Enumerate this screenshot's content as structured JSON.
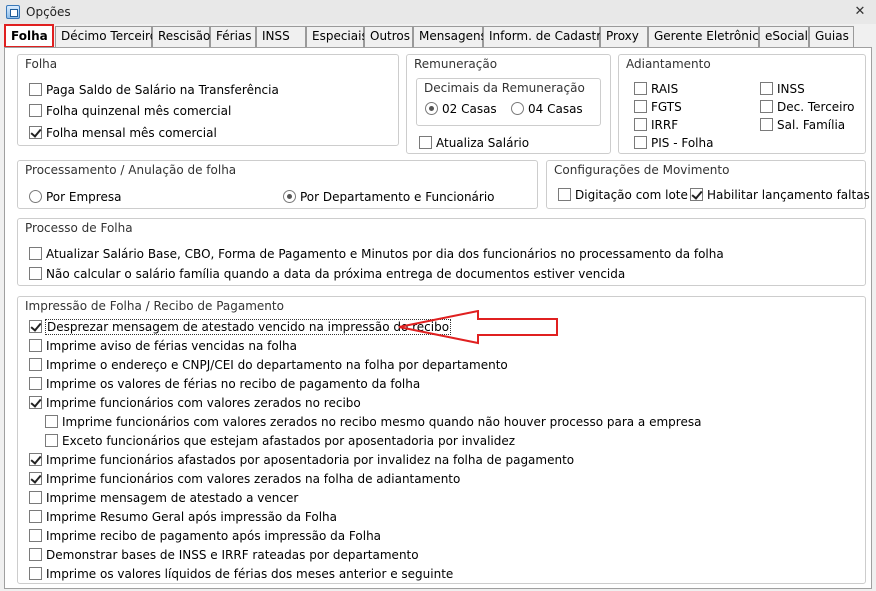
{
  "window": {
    "title": "Opções",
    "close_symbol": "✕"
  },
  "tabs": [
    "Folha",
    "Décimo Terceiro",
    "Rescisão",
    "Férias",
    "INSS",
    "Especiais",
    "Outros",
    "Mensagens",
    "Inform. de Cadastro",
    "Proxy",
    "Gerente Eletrônico",
    "eSocial",
    "Guias"
  ],
  "folha": {
    "title": "Folha",
    "items": [
      {
        "label": "Paga Saldo de Salário na Transferência",
        "checked": false
      },
      {
        "label": "Folha quinzenal mês comercial",
        "checked": false
      },
      {
        "label": "Folha mensal mês comercial",
        "checked": true
      }
    ]
  },
  "remuneracao": {
    "title": "Remuneração",
    "decimais": {
      "title": "Decimais da Remuneração",
      "options": [
        {
          "label": "02 Casas",
          "selected": true
        },
        {
          "label": "04 Casas",
          "selected": false
        }
      ]
    },
    "atualiza": {
      "label": "Atualiza Salário",
      "checked": false
    }
  },
  "adiantamento": {
    "title": "Adiantamento",
    "col1": [
      {
        "label": "RAIS",
        "checked": false
      },
      {
        "label": "FGTS",
        "checked": false
      },
      {
        "label": "IRRF",
        "checked": false
      },
      {
        "label": "PIS - Folha",
        "checked": false
      }
    ],
    "col2": [
      {
        "label": "INSS",
        "checked": false
      },
      {
        "label": "Dec. Terceiro",
        "checked": false
      },
      {
        "label": "Sal. Família",
        "checked": false
      }
    ]
  },
  "processamento": {
    "title": "Processamento / Anulação de folha",
    "options": [
      {
        "label": "Por Empresa",
        "selected": false
      },
      {
        "label": "Por Departamento e Funcionário",
        "selected": true
      }
    ]
  },
  "movimento": {
    "title": "Configurações de Movimento",
    "items": [
      {
        "label": "Digitação com lote",
        "checked": false
      },
      {
        "label": "Habilitar lançamento faltas",
        "checked": true
      }
    ]
  },
  "processo": {
    "title": "Processo de Folha",
    "items": [
      {
        "label": "Atualizar Salário Base, CBO, Forma de Pagamento e Minutos por dia dos funcionários no processamento da folha",
        "checked": false
      },
      {
        "label": "Não calcular o salário família quando a data da próxima entrega de documentos estiver vencida",
        "checked": false
      }
    ]
  },
  "impressao": {
    "title": "Impressão de Folha / Recibo de Pagamento",
    "items": [
      {
        "label": "Desprezar mensagem de atestado vencido na impressão do recibo",
        "checked": true,
        "indent": false
      },
      {
        "label": "Imprime aviso de férias vencidas na folha",
        "checked": false,
        "indent": false
      },
      {
        "label": "Imprime o endereço e CNPJ/CEI do departamento na folha por departamento",
        "checked": false,
        "indent": false
      },
      {
        "label": "Imprime os valores de férias no recibo de pagamento da folha",
        "checked": false,
        "indent": false
      },
      {
        "label": "Imprime funcionários com valores zerados no recibo",
        "checked": true,
        "indent": false
      },
      {
        "label": "Imprime funcionários com valores zerados no recibo mesmo quando não houver processo para a empresa",
        "checked": false,
        "indent": true
      },
      {
        "label": "Exceto funcionários que estejam afastados por aposentadoria por invalidez",
        "checked": false,
        "indent": true
      },
      {
        "label": "Imprime funcionários afastados por aposentadoria por invalidez na folha de pagamento",
        "checked": true,
        "indent": false
      },
      {
        "label": "Imprime funcionários com valores zerados na folha de adiantamento",
        "checked": true,
        "indent": false
      },
      {
        "label": "Imprime mensagem de  atestado a vencer",
        "checked": false,
        "indent": false
      },
      {
        "label": "Imprime Resumo Geral após impressão da Folha",
        "checked": false,
        "indent": false
      },
      {
        "label": "Imprime recibo de pagamento após impressão da Folha",
        "checked": false,
        "indent": false
      },
      {
        "label": "Demonstrar bases de INSS e IRRF rateadas por departamento",
        "checked": false,
        "indent": false
      },
      {
        "label": "Imprime os valores líquidos de férias dos meses anterior e seguinte",
        "checked": false,
        "indent": false
      }
    ]
  },
  "colors": {
    "highlight": "#e02020"
  }
}
